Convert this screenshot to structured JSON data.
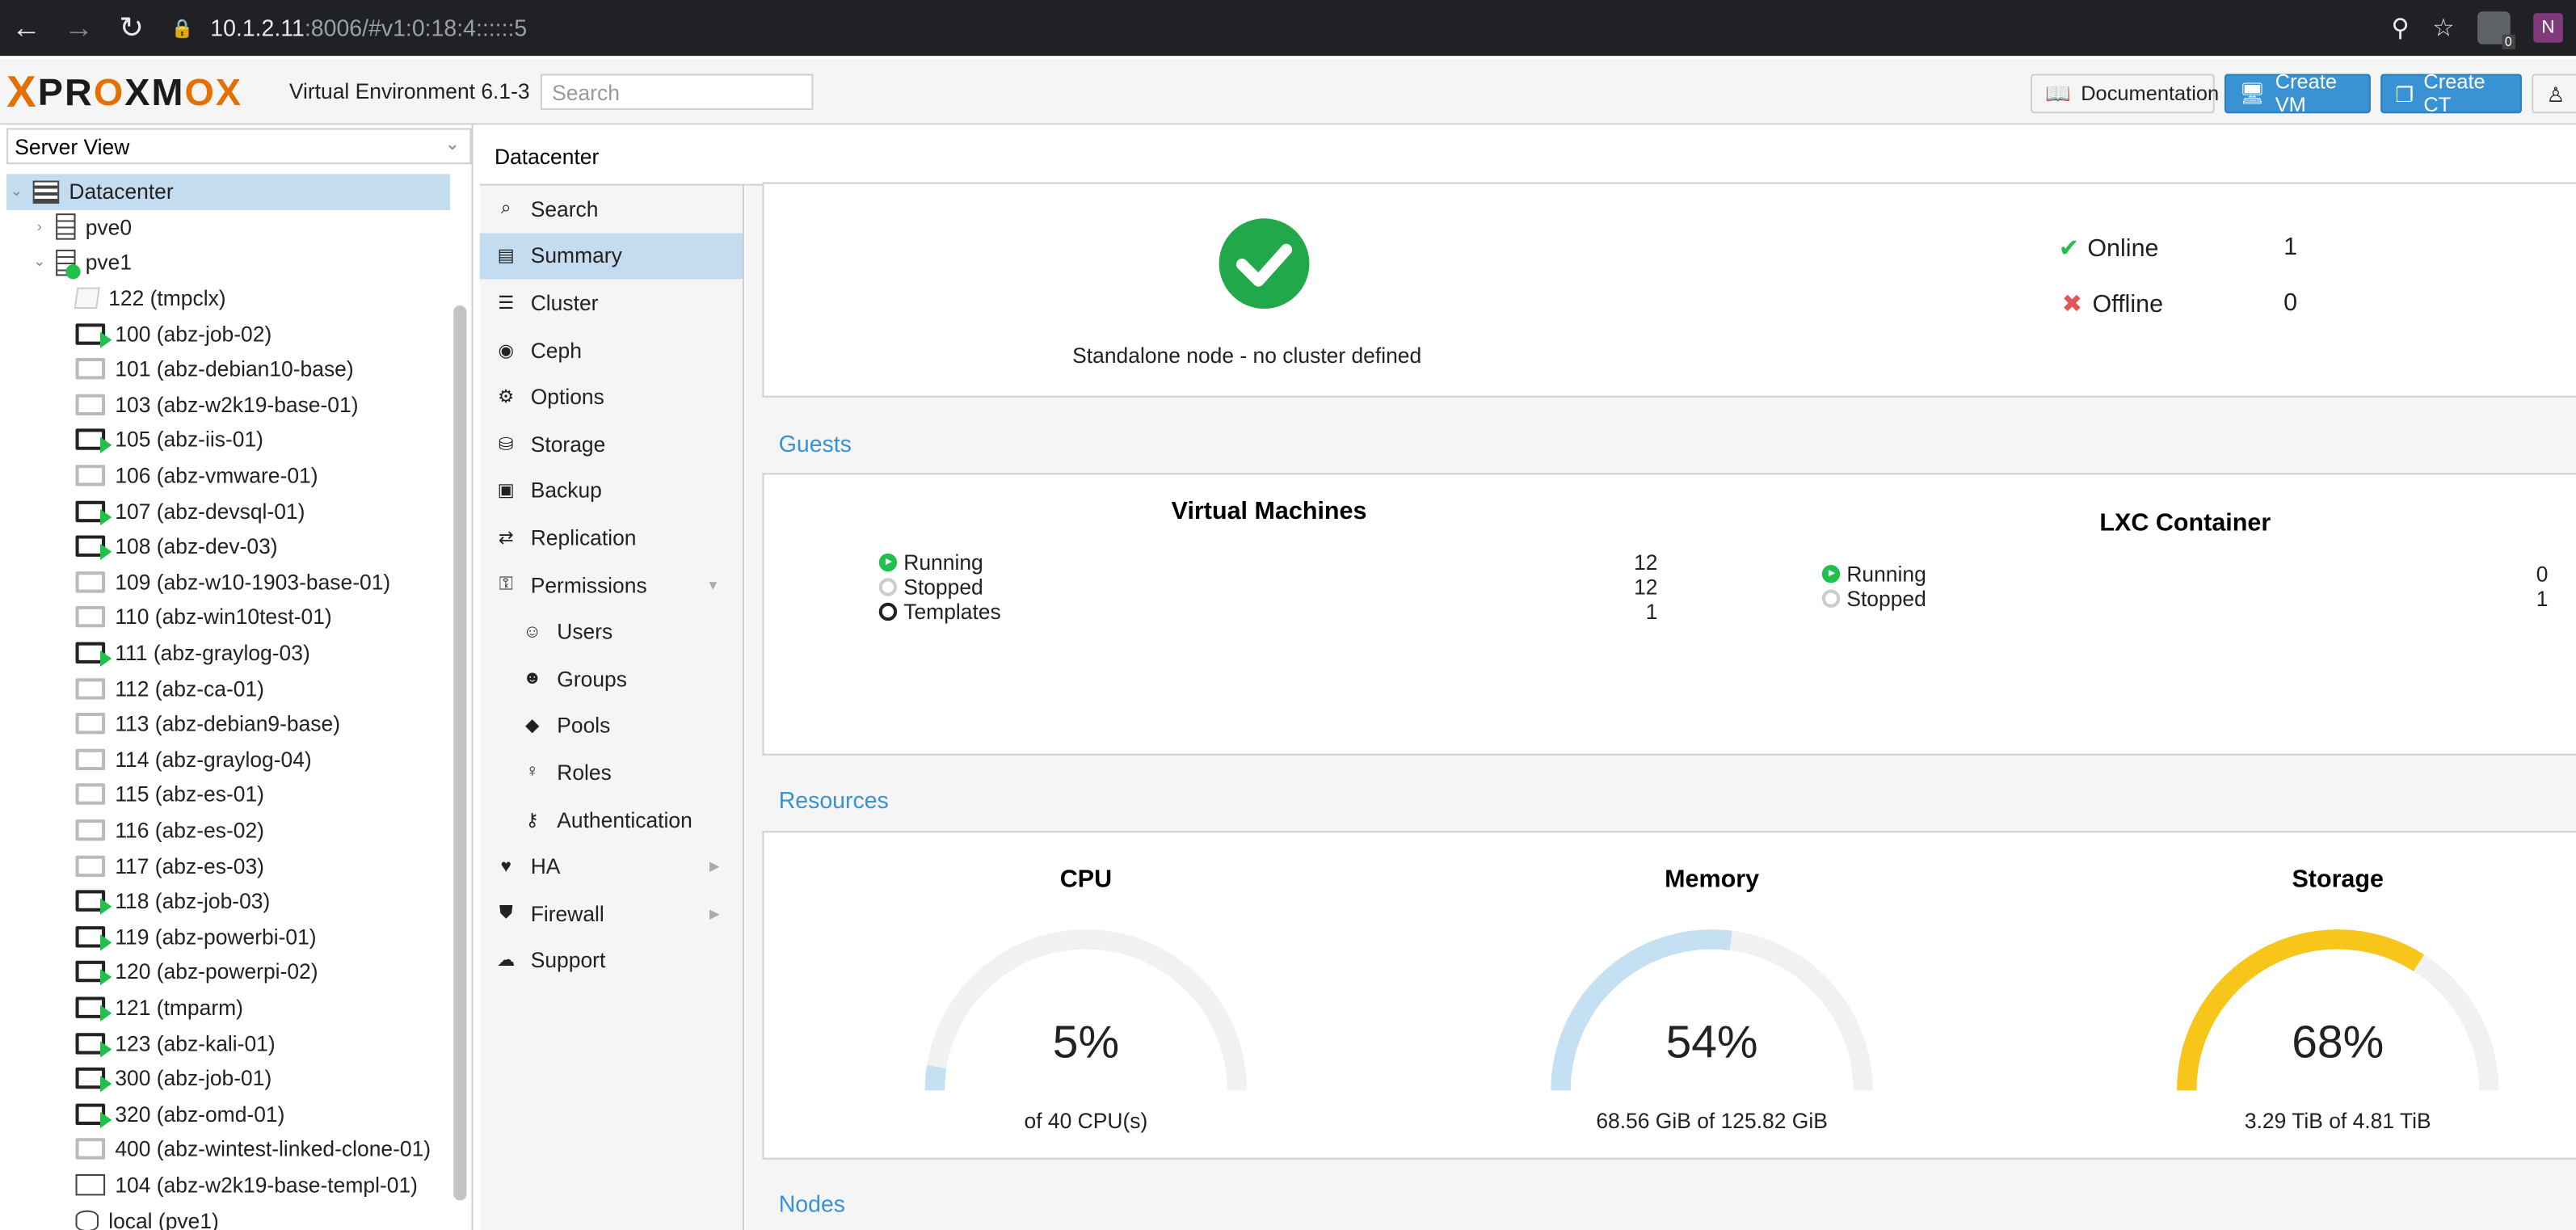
{
  "browser": {
    "url_host": "10.1.2.11",
    "url_path": ":8006/#v1:0:18:4::::::5",
    "ext_badge": "0",
    "ext2_label": "N"
  },
  "header": {
    "logo_text": "PROXMOX",
    "version": "Virtual Environment 6.1-3",
    "search_placeholder": "Search",
    "doc_label": "Documentation",
    "create_vm_label": "Create VM",
    "create_ct_label": "Create CT"
  },
  "left": {
    "view": "Server View",
    "tree": [
      {
        "label": "Datacenter",
        "type": "datacenter",
        "level": 0,
        "expand": "v",
        "selected": true
      },
      {
        "label": "pve0",
        "type": "node",
        "level": 1,
        "expand": ">"
      },
      {
        "label": "pve1",
        "type": "node-ok",
        "level": 1,
        "expand": "v"
      },
      {
        "label": "122 (tmpclx)",
        "type": "ct",
        "level": 2
      },
      {
        "label": "100 (abz-job-02)",
        "type": "vm-run",
        "level": 2
      },
      {
        "label": "101 (abz-debian10-base)",
        "type": "vm-off",
        "level": 2
      },
      {
        "label": "103 (abz-w2k19-base-01)",
        "type": "vm-off",
        "level": 2
      },
      {
        "label": "105 (abz-iis-01)",
        "type": "vm-run",
        "level": 2
      },
      {
        "label": "106 (abz-vmware-01)",
        "type": "vm-off",
        "level": 2
      },
      {
        "label": "107 (abz-devsql-01)",
        "type": "vm-run",
        "level": 2
      },
      {
        "label": "108 (abz-dev-03)",
        "type": "vm-run",
        "level": 2
      },
      {
        "label": "109 (abz-w10-1903-base-01)",
        "type": "vm-off",
        "level": 2
      },
      {
        "label": "110 (abz-win10test-01)",
        "type": "vm-off",
        "level": 2
      },
      {
        "label": "111 (abz-graylog-03)",
        "type": "vm-run",
        "level": 2
      },
      {
        "label": "112 (abz-ca-01)",
        "type": "vm-off",
        "level": 2
      },
      {
        "label": "113 (abz-debian9-base)",
        "type": "vm-off",
        "level": 2
      },
      {
        "label": "114 (abz-graylog-04)",
        "type": "vm-off",
        "level": 2
      },
      {
        "label": "115 (abz-es-01)",
        "type": "vm-off",
        "level": 2
      },
      {
        "label": "116 (abz-es-02)",
        "type": "vm-off",
        "level": 2
      },
      {
        "label": "117 (abz-es-03)",
        "type": "vm-off",
        "level": 2
      },
      {
        "label": "118 (abz-job-03)",
        "type": "vm-run",
        "level": 2
      },
      {
        "label": "119 (abz-powerbi-01)",
        "type": "vm-run",
        "level": 2
      },
      {
        "label": "120 (abz-powerpi-02)",
        "type": "vm-run",
        "level": 2
      },
      {
        "label": "121 (tmparm)",
        "type": "vm-run",
        "level": 2
      },
      {
        "label": "123 (abz-kali-01)",
        "type": "vm-run",
        "level": 2
      },
      {
        "label": "300 (abz-job-01)",
        "type": "vm-run",
        "level": 2
      },
      {
        "label": "320 (abz-omd-01)",
        "type": "vm-run",
        "level": 2
      },
      {
        "label": "400 (abz-wintest-linked-clone-01)",
        "type": "vm-off",
        "level": 2
      },
      {
        "label": "104 (abz-w2k19-base-templ-01)",
        "type": "template",
        "level": 2
      },
      {
        "label": "local (pve1)",
        "type": "storage",
        "level": 2
      }
    ]
  },
  "breadcrumb": "Datacenter",
  "menu": [
    {
      "label": "Search",
      "icon": "⌕",
      "sub": false
    },
    {
      "label": "Summary",
      "icon": "▤",
      "sub": false,
      "selected": true
    },
    {
      "label": "Cluster",
      "icon": "☰",
      "sub": false
    },
    {
      "label": "Ceph",
      "icon": "◉",
      "sub": false
    },
    {
      "label": "Options",
      "icon": "⚙",
      "sub": false
    },
    {
      "label": "Storage",
      "icon": "⛁",
      "sub": false
    },
    {
      "label": "Backup",
      "icon": "▣",
      "sub": false
    },
    {
      "label": "Replication",
      "icon": "⇄",
      "sub": false
    },
    {
      "label": "Permissions",
      "icon": "⚿",
      "sub": false,
      "arrow": "▼"
    },
    {
      "label": "Users",
      "icon": "☺",
      "sub": true
    },
    {
      "label": "Groups",
      "icon": "☻",
      "sub": true
    },
    {
      "label": "Pools",
      "icon": "◆",
      "sub": true
    },
    {
      "label": "Roles",
      "icon": "♀",
      "sub": true
    },
    {
      "label": "Authentication",
      "icon": "⚷",
      "sub": true
    },
    {
      "label": "HA",
      "icon": "♥",
      "sub": false,
      "arrow": "▶"
    },
    {
      "label": "Firewall",
      "icon": "⛊",
      "sub": false,
      "arrow": "▶"
    },
    {
      "label": "Support",
      "icon": "☁",
      "sub": false
    }
  ],
  "health": {
    "cluster_text": "Standalone node - no cluster defined",
    "online_label": "Online",
    "online_count": "1",
    "offline_label": "Offline",
    "offline_count": "0"
  },
  "guests": {
    "title": "Guests",
    "vm_title": "Virtual Machines",
    "vm": [
      {
        "label": "Running",
        "value": "12",
        "kind": "run"
      },
      {
        "label": "Stopped",
        "value": "12",
        "kind": "stop"
      },
      {
        "label": "Templates",
        "value": "1",
        "kind": "tpl"
      }
    ],
    "ct_title": "LXC Container",
    "ct": [
      {
        "label": "Running",
        "value": "0",
        "kind": "run"
      },
      {
        "label": "Stopped",
        "value": "1",
        "kind": "stop"
      }
    ]
  },
  "resources": {
    "title": "Resources",
    "gauges": [
      {
        "name": "CPU",
        "percent": 5,
        "percent_text": "5%",
        "sub": "of 40 CPU(s)",
        "color": "#c5dff3"
      },
      {
        "name": "Memory",
        "percent": 54,
        "percent_text": "54%",
        "sub": "68.56 GiB of 125.82 GiB",
        "color": "#c5dff3"
      },
      {
        "name": "Storage",
        "percent": 68,
        "percent_text": "68%",
        "sub": "3.29 TiB of 4.81 TiB",
        "color": "#f8c61a"
      }
    ]
  },
  "nodes_title": "Nodes",
  "colors": {
    "accent": "#3892d4",
    "selected_bg": "#c4dcf0",
    "ok_green": "#21bf4b",
    "error_red": "#e05555",
    "gauge_track": "#f1f1f1"
  }
}
